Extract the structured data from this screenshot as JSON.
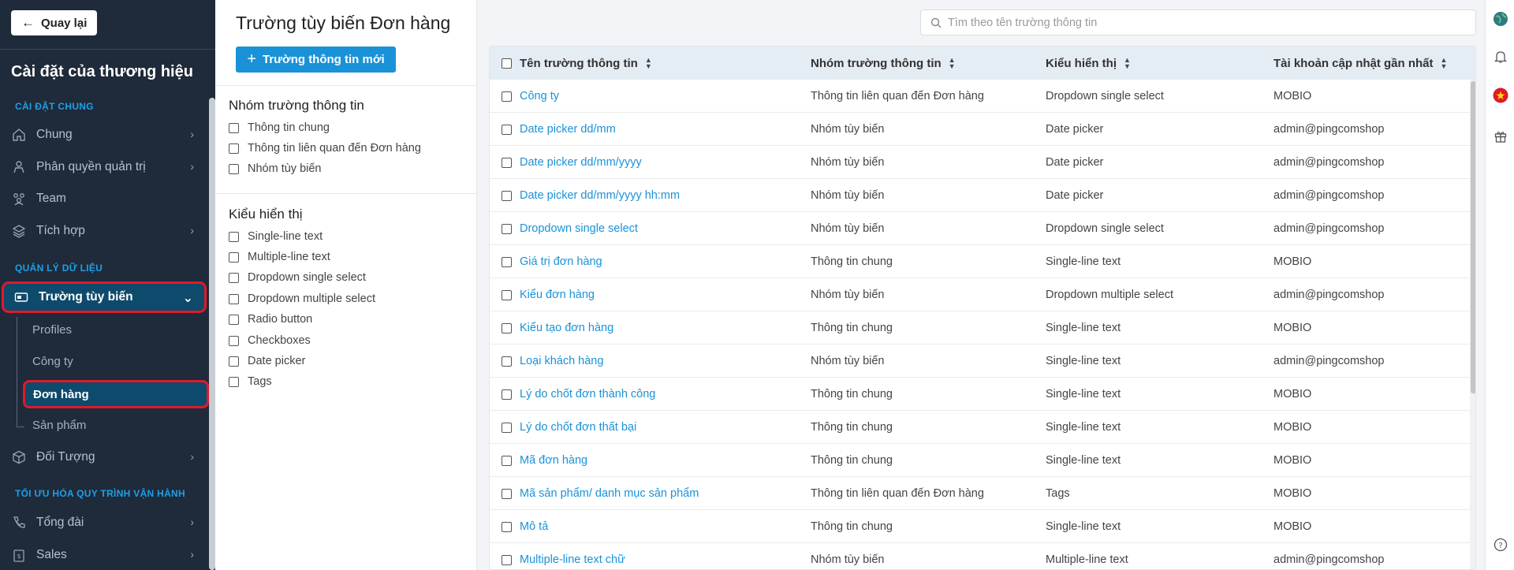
{
  "sidebar": {
    "back_label": "Quay lại",
    "brand_title": "Cài đặt của thương hiệu",
    "section_general": "CÀI ĐẶT CHUNG",
    "section_data": "QUẢN LÝ DỮ LIỆU",
    "section_ops": "TỐI ƯU HÓA QUY TRÌNH VẬN HÀNH",
    "items": {
      "chung": "Chung",
      "phanquyen": "Phân quyền quản trị",
      "team": "Team",
      "tichhop": "Tích hợp",
      "truong": "Trường tùy biến",
      "doituong": "Đối Tượng",
      "tongdai": "Tổng đài",
      "sales": "Sales"
    },
    "sub_items": [
      "Profiles",
      "Công ty",
      "Đơn hàng",
      "Sản phẩm"
    ]
  },
  "filter": {
    "page_title": "Trường tùy biến Đơn hàng",
    "new_button": "Trường thông tin mới",
    "group_heading": "Nhóm trường thông tin",
    "group_options": [
      "Thông tin chung",
      "Thông tin liên quan đến Đơn hàng",
      "Nhóm tùy biến"
    ],
    "display_heading": "Kiểu hiển thị",
    "display_options": [
      "Single-line text",
      "Multiple-line text",
      "Dropdown single select",
      "Dropdown multiple select",
      "Radio button",
      "Checkboxes",
      "Date picker",
      "Tags"
    ]
  },
  "search": {
    "placeholder": "Tìm theo tên trường thông tin"
  },
  "table": {
    "headers": [
      "Tên trường thông tin",
      "Nhóm trường thông tin",
      "Kiểu hiển thị",
      "Tài khoản cập nhật gần nhất"
    ],
    "rows": [
      [
        "Công ty",
        "Thông tin liên quan đến Đơn hàng",
        "Dropdown single select",
        "MOBIO"
      ],
      [
        "Date picker dd/mm",
        "Nhóm tùy biến",
        "Date picker",
        "admin@pingcomshop"
      ],
      [
        "Date picker dd/mm/yyyy",
        "Nhóm tùy biến",
        "Date picker",
        "admin@pingcomshop"
      ],
      [
        "Date picker dd/mm/yyyy hh:mm",
        "Nhóm tùy biến",
        "Date picker",
        "admin@pingcomshop"
      ],
      [
        "Dropdown single select",
        "Nhóm tùy biến",
        "Dropdown single select",
        "admin@pingcomshop"
      ],
      [
        "Giá trị đơn hàng",
        "Thông tin chung",
        "Single-line text",
        "MOBIO"
      ],
      [
        "Kiểu đơn hàng",
        "Nhóm tùy biến",
        "Dropdown multiple select",
        "admin@pingcomshop"
      ],
      [
        "Kiểu tạo đơn hàng",
        "Thông tin chung",
        "Single-line text",
        "MOBIO"
      ],
      [
        "Loại khách hàng",
        "Nhóm tùy biến",
        "Single-line text",
        "admin@pingcomshop"
      ],
      [
        "Lý do chốt đơn thành công",
        "Thông tin chung",
        "Single-line text",
        "MOBIO"
      ],
      [
        "Lý do chốt đơn thất bại",
        "Thông tin chung",
        "Single-line text",
        "MOBIO"
      ],
      [
        "Mã đơn hàng",
        "Thông tin chung",
        "Single-line text",
        "MOBIO"
      ],
      [
        "Mã sản phẩm/ danh mục sản phẩm",
        "Thông tin liên quan đến Đơn hàng",
        "Tags",
        "MOBIO"
      ],
      [
        "Mô tả",
        "Thông tin chung",
        "Single-line text",
        "MOBIO"
      ],
      [
        "Multiple-line text chữ",
        "Nhóm tùy biến",
        "Multiple-line text",
        "admin@pingcomshop"
      ]
    ]
  },
  "rail": {
    "icons": [
      "globe-icon",
      "bell-icon",
      "vietnam-flag-icon",
      "gift-icon",
      "help-icon"
    ]
  },
  "colors": {
    "sidebar_bg": "#1f2a3a",
    "accent": "#1a92d8",
    "active_bg": "#0e4a6c",
    "highlight": "#e0192a"
  }
}
